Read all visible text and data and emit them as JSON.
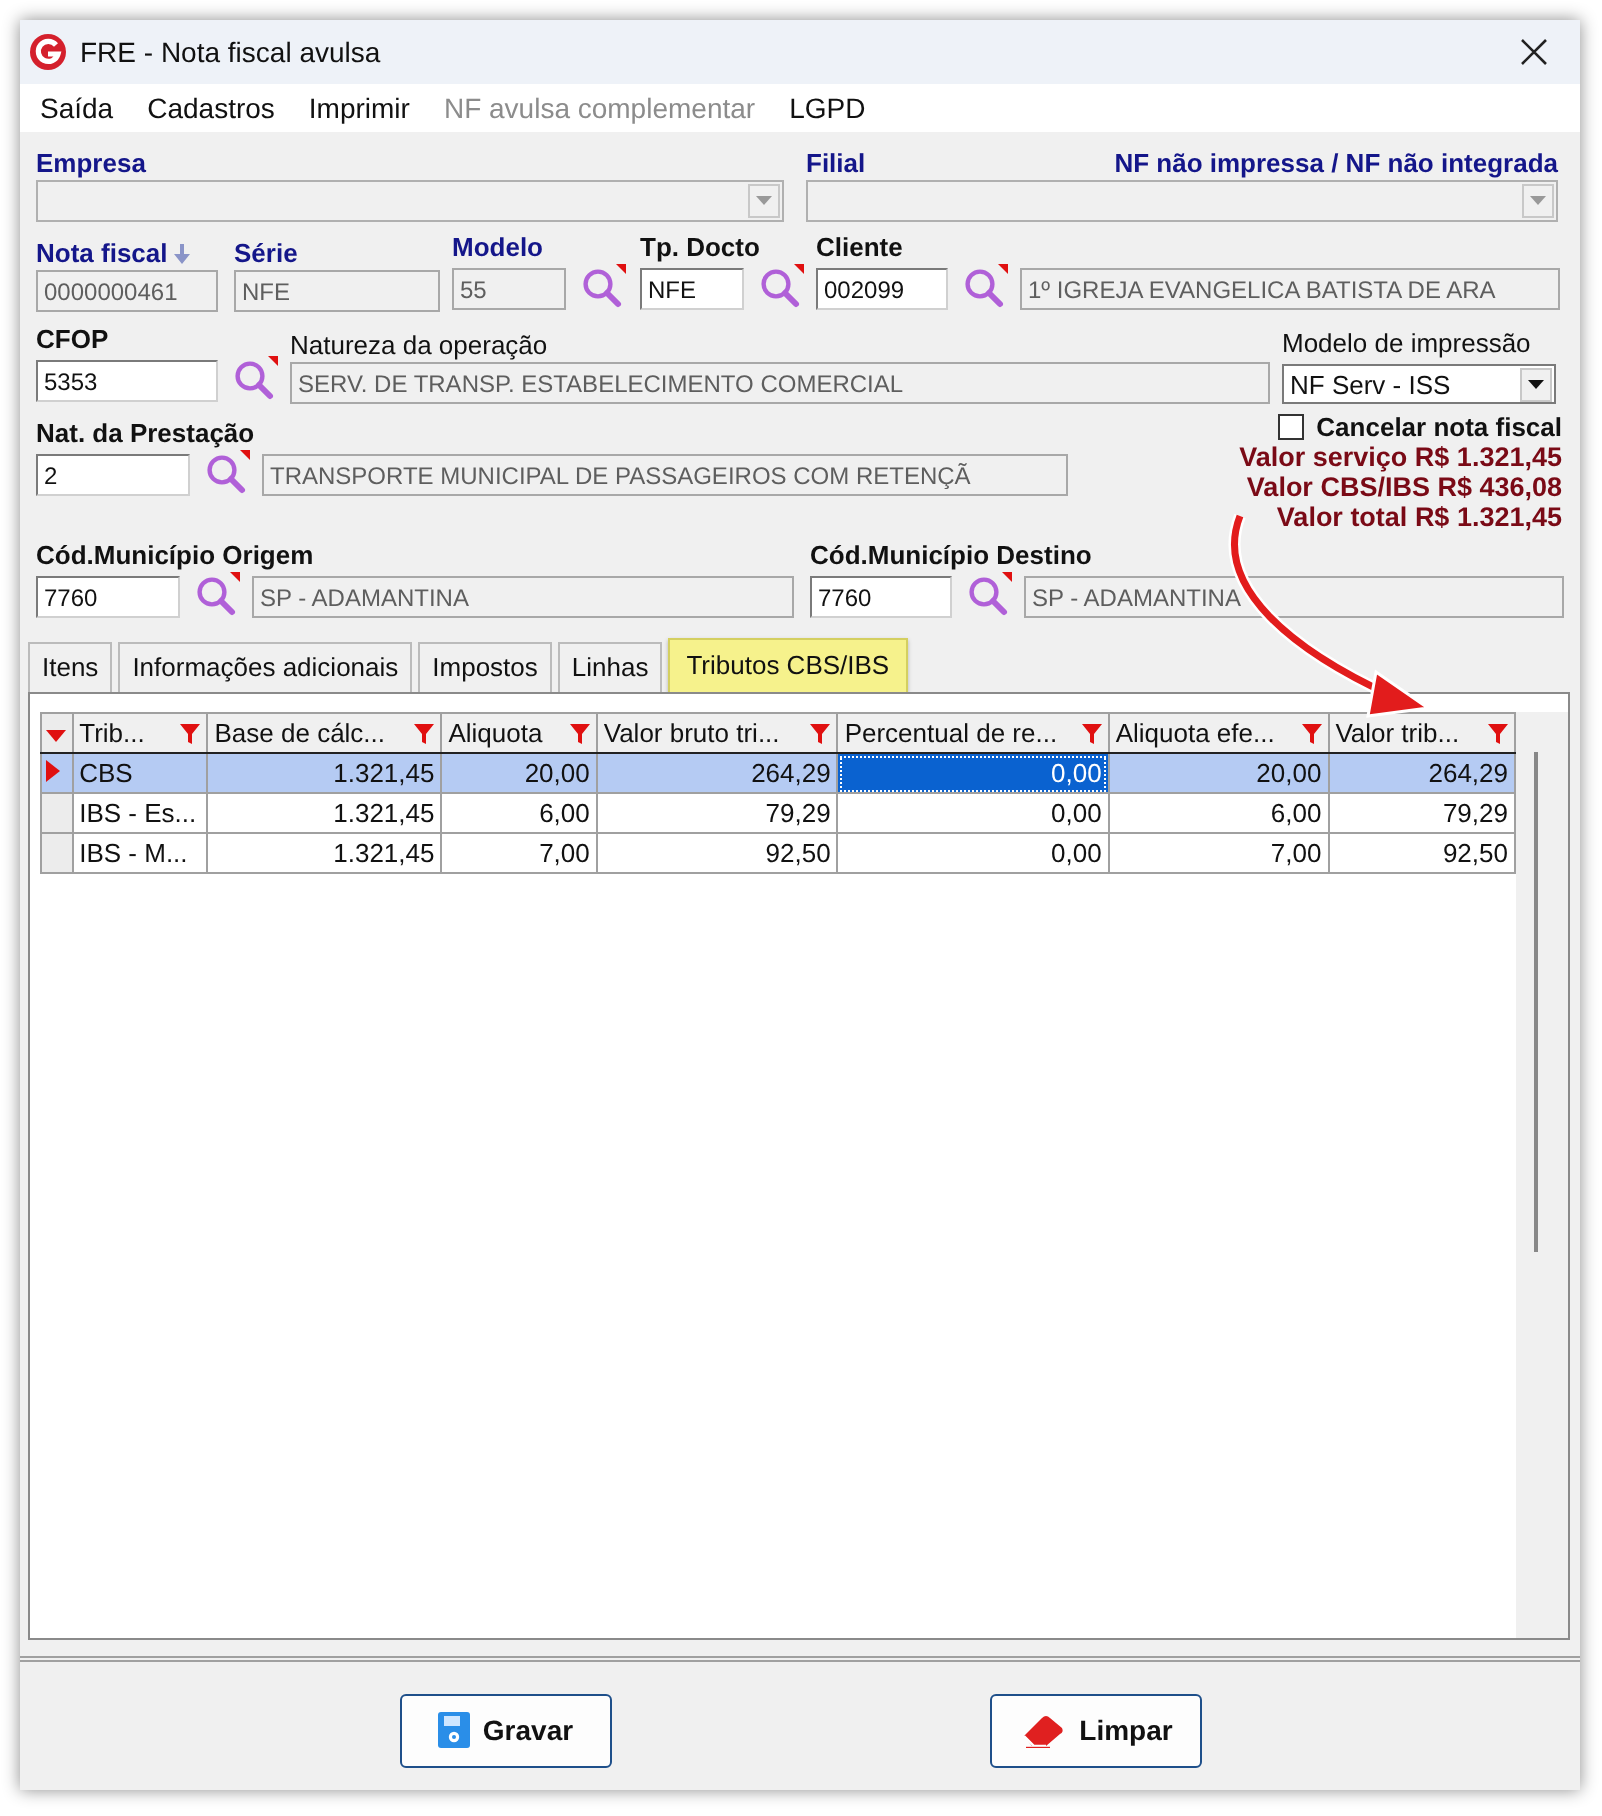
{
  "window": {
    "title": "FRE - Nota fiscal avulsa"
  },
  "menu": [
    {
      "label": "Saída",
      "disabled": false
    },
    {
      "label": "Cadastros",
      "disabled": false
    },
    {
      "label": "Imprimir",
      "disabled": false
    },
    {
      "label": "NF avulsa complementar",
      "disabled": true
    },
    {
      "label": "LGPD",
      "disabled": false
    }
  ],
  "empresa": {
    "label": "Empresa",
    "required": true,
    "disabled": true
  },
  "filial": {
    "label": "Filial",
    "required": true,
    "disabled": true
  },
  "nf_status": "NF não impressa / NF não integrada",
  "nota_fiscal": {
    "label": "Nota fiscal",
    "required": true,
    "value": "0000000461",
    "disabled": true
  },
  "serie": {
    "label": "Série",
    "required": true,
    "value": "NFE",
    "disabled": true
  },
  "modelo": {
    "label": "Modelo",
    "required": true,
    "value": "55",
    "disabled": true
  },
  "tp_docto": {
    "label": "Tp. Docto",
    "required": false,
    "value": "NFE",
    "disabled": false
  },
  "cliente": {
    "label": "Cliente",
    "required": false,
    "value": "002099",
    "disabled": false
  },
  "cliente_nome": {
    "value": "1º IGREJA EVANGELICA BATISTA DE ARA",
    "disabled": true
  },
  "cfop": {
    "label": "CFOP",
    "required": false,
    "value": "5353",
    "disabled": false
  },
  "natureza": {
    "label": "Natureza da operação",
    "value": "SERV. DE TRANSP. ESTABELECIMENTO COMERCIAL",
    "disabled": true
  },
  "modelo_impressao": {
    "label": "Modelo de impressão",
    "value": "NF Serv - ISS"
  },
  "nat_prestacao": {
    "label": "Nat. da Prestação",
    "required": false,
    "value": "2",
    "disabled": false
  },
  "nat_prestacao_desc": {
    "value": "TRANSPORTE MUNICIPAL DE PASSAGEIROS COM RETENÇÃ",
    "disabled": true
  },
  "cancelar": {
    "label": "Cancelar nota fiscal",
    "checked": false
  },
  "totals": [
    "Valor serviço R$ 1.321,45",
    "Valor CBS/IBS R$ 436,08",
    "Valor total R$ 1.321,45"
  ],
  "origem": {
    "label": "Cód.Município Origem",
    "required": false,
    "value": "7760",
    "disabled": false
  },
  "origem_nome": {
    "value": "SP - ADAMANTINA",
    "disabled": true
  },
  "destino": {
    "label": "Cód.Município Destino",
    "required": false,
    "value": "7760",
    "disabled": false
  },
  "destino_nome": {
    "value": "SP - ADAMANTINA",
    "disabled": true
  },
  "tabs": [
    {
      "label": "Itens",
      "selected": false
    },
    {
      "label": "Informações adicionais",
      "selected": false
    },
    {
      "label": "Impostos",
      "selected": false
    },
    {
      "label": "Linhas",
      "selected": false
    },
    {
      "label": "Tributos CBS/IBS",
      "selected": true
    }
  ],
  "table": {
    "columns": [
      {
        "label": "Trib...",
        "focused": false
      },
      {
        "label": "Base de cálc...",
        "focused": false
      },
      {
        "label": "Aliquota",
        "focused": false
      },
      {
        "label": "Valor bruto tri...",
        "focused": false
      },
      {
        "label": "Percentual de re...",
        "focused": true
      },
      {
        "label": "Aliquota efe...",
        "focused": false
      },
      {
        "label": "Valor trib...",
        "focused": false
      }
    ],
    "rows": [
      {
        "selected": true,
        "cells": [
          "CBS",
          "1.321,45",
          "20,00",
          "264,29",
          "0,00",
          "20,00",
          "264,29"
        ]
      },
      {
        "selected": false,
        "cells": [
          "IBS - Es...",
          "1.321,45",
          "6,00",
          "79,29",
          "0,00",
          "6,00",
          "79,29"
        ]
      },
      {
        "selected": false,
        "cells": [
          "IBS - M...",
          "1.321,45",
          "7,00",
          "92,50",
          "0,00",
          "7,00",
          "92,50"
        ]
      }
    ]
  },
  "buttons": [
    {
      "label": "Gravar",
      "kind": "save"
    },
    {
      "label": "Limpar",
      "kind": "clear"
    }
  ]
}
